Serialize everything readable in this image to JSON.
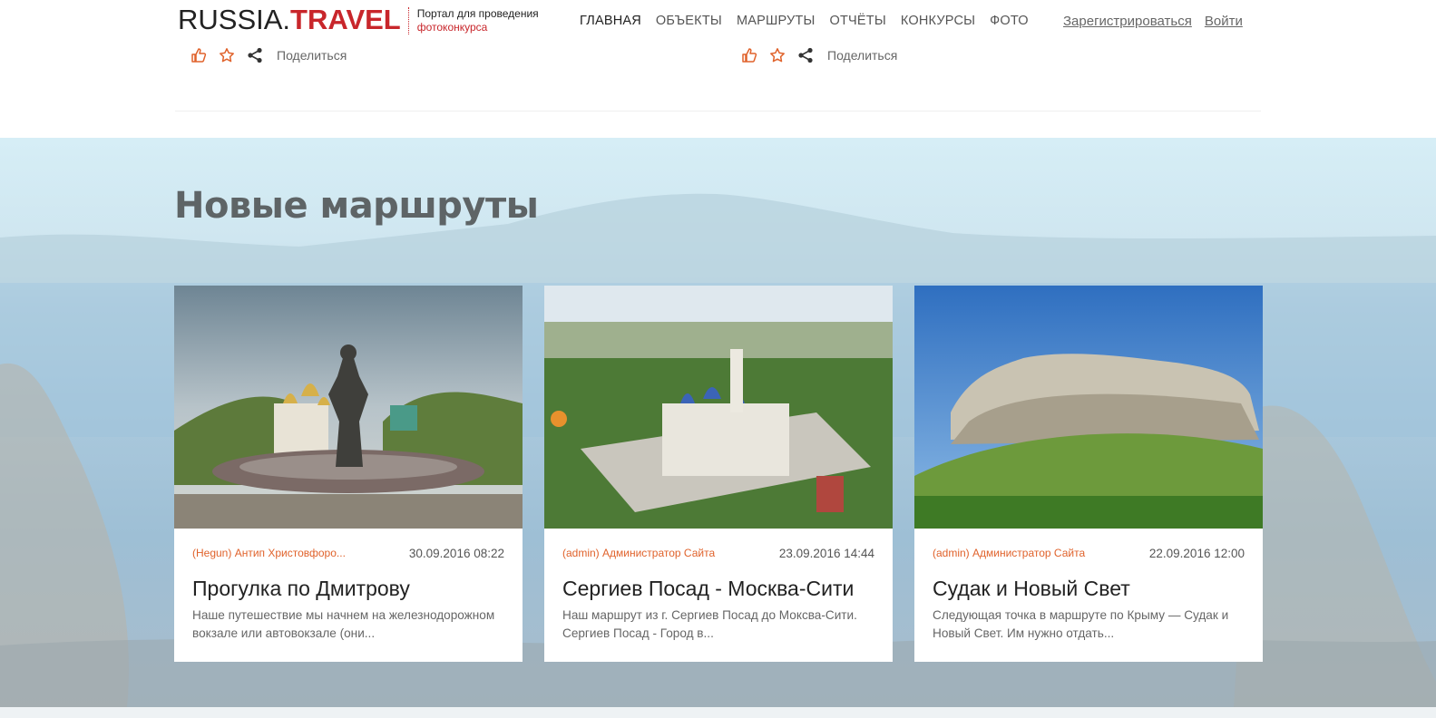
{
  "header": {
    "logo_main": "RUSSIA.",
    "logo_accent": "TRAVEL",
    "tagline_line1": "Портал для проведения",
    "tagline_line2": "фотоконкурса",
    "nav": [
      "ГЛАВНАЯ",
      "ОБЪЕКТЫ",
      "МАРШРУТЫ",
      "ОТЧЁТЫ",
      "КОНКУРСЫ",
      "ФОТО"
    ],
    "register": "Зарегистрироваться",
    "login": "Войти"
  },
  "share_rows": [
    {
      "label": "Поделиться"
    },
    {
      "label": "Поделиться"
    }
  ],
  "section": {
    "title": "Новые маршруты"
  },
  "cards": [
    {
      "author": "(Hegun) Антип Христовфоро...",
      "date": "30.09.2016 08:22",
      "title": "Прогулка по Дмитрову",
      "excerpt": "Наше путешествие мы начнем на железнодорожном вокзале или автовокзале (они..."
    },
    {
      "author": "(admin) Администратор Сайта",
      "date": "23.09.2016 14:44",
      "title": "Сергиев Посад - Москва-Сити",
      "excerpt": "Наш маршрут из г. Сергиев Посад до Моксва-Сити. Сергиев Посад - Город в..."
    },
    {
      "author": "(admin) Администратор Сайта",
      "date": "22.09.2016 12:00",
      "title": "Судак и Новый Свет",
      "excerpt": "Следующая точка в маршруте по Крыму — Судак и Новый Свет. Им нужно отдать..."
    }
  ],
  "colors": {
    "accent_red": "#c8262b",
    "author_orange": "#e0622b",
    "icon_orange": "#e0622b"
  }
}
